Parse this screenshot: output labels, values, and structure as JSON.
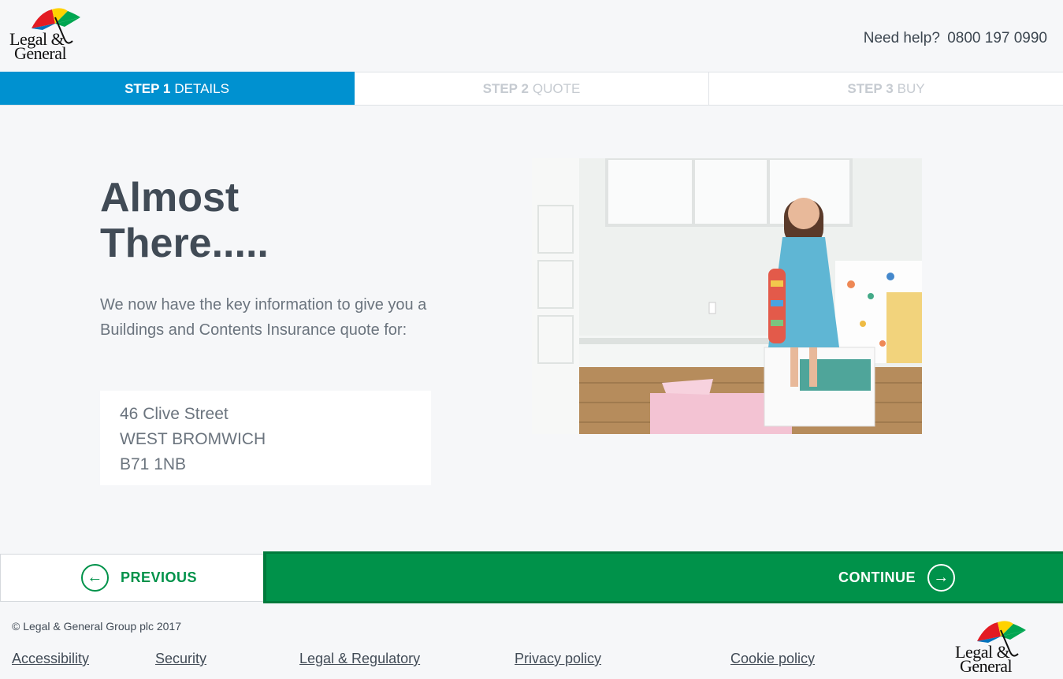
{
  "header": {
    "logo_line1": "Legal &",
    "logo_line2": "General",
    "help_label": "Need help?",
    "help_phone": "0800 197 0990"
  },
  "steps": [
    {
      "num": "STEP 1",
      "label": "DETAILS",
      "active": true
    },
    {
      "num": "STEP 2",
      "label": "QUOTE",
      "active": false
    },
    {
      "num": "STEP 3",
      "label": "BUY",
      "active": false
    }
  ],
  "main": {
    "title_line1": "Almost",
    "title_line2": "There.....",
    "intro": "We now have the key information to give you a Buildings and Contents Insurance quote for:",
    "address": {
      "line1": "46 Clive Street",
      "line2": "WEST BROMWICH",
      "line3": "B71 1NB"
    }
  },
  "nav": {
    "previous_label": "PREVIOUS",
    "continue_label": "CONTINUE"
  },
  "footer": {
    "copyright": "© Legal & General Group plc 2017",
    "links": [
      "Accessibility",
      "Security",
      "Legal & Regulatory",
      "Privacy policy",
      "Cookie policy"
    ]
  },
  "colors": {
    "step_active": "#0091d0",
    "continue_green": "#00924a",
    "background": "#f6f7f9"
  }
}
